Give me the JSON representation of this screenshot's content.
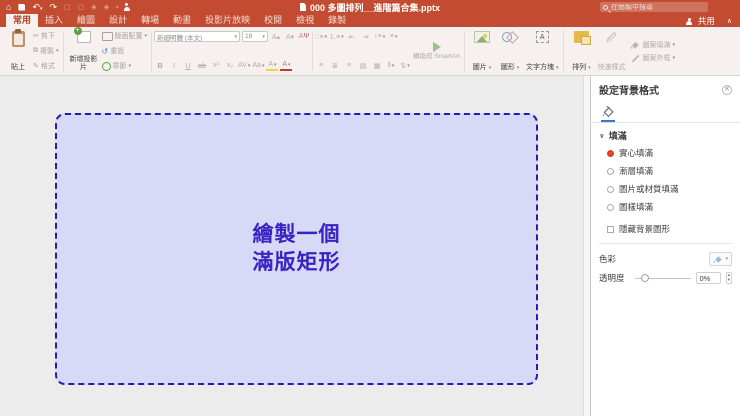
{
  "titlebar": {
    "title": "000 多圖排列__進階篇合集.pptx",
    "search_placeholder": "在簡報中搜尋",
    "share_label": "共用"
  },
  "tabs": [
    {
      "label": "常用",
      "active": true
    },
    {
      "label": "插入"
    },
    {
      "label": "繪圖"
    },
    {
      "label": "設計"
    },
    {
      "label": "轉場"
    },
    {
      "label": "動畫"
    },
    {
      "label": "投影片放映"
    },
    {
      "label": "校閱"
    },
    {
      "label": "檢視"
    },
    {
      "label": "錄製"
    }
  ],
  "ribbon": {
    "paste": "貼上",
    "cut": "剪下",
    "copy": "複製",
    "format_painter": "格式",
    "new_slide": "新增投影片",
    "layout": "版面配置",
    "reset": "重設",
    "section": "章節",
    "font_name": "新細明體 (本文)",
    "font_size": "18",
    "smartart": "轉換成 SmartArt",
    "picture": "圖片",
    "shapes": "圖形",
    "textbox": "文字方塊",
    "arrange": "排列",
    "quick_styles": "快速樣式",
    "shape_fill": "圖案填滿",
    "shape_outline": "圖案外框"
  },
  "slide": {
    "line1": "繪製一個",
    "line2": "滿版矩形",
    "fill_color": "#d8d8f7",
    "border_color": "#2a1ab0",
    "text_color": "#3a23c4"
  },
  "panel": {
    "title": "設定背景格式",
    "section_fill": "填滿",
    "options": [
      {
        "label": "實心填滿",
        "selected": true
      },
      {
        "label": "漸層填滿",
        "selected": false
      },
      {
        "label": "圖片或材質填滿",
        "selected": false
      },
      {
        "label": "圖樣填滿",
        "selected": false
      }
    ],
    "hide_background": "隱藏背景圖形",
    "color_label": "色彩",
    "transparency_label": "透明度",
    "transparency_value": "0%"
  },
  "colors": {
    "titlebar_red": "#c24b31",
    "radio_accent": "#d8431f",
    "panel_tab_underline": "#2b7bd4"
  }
}
